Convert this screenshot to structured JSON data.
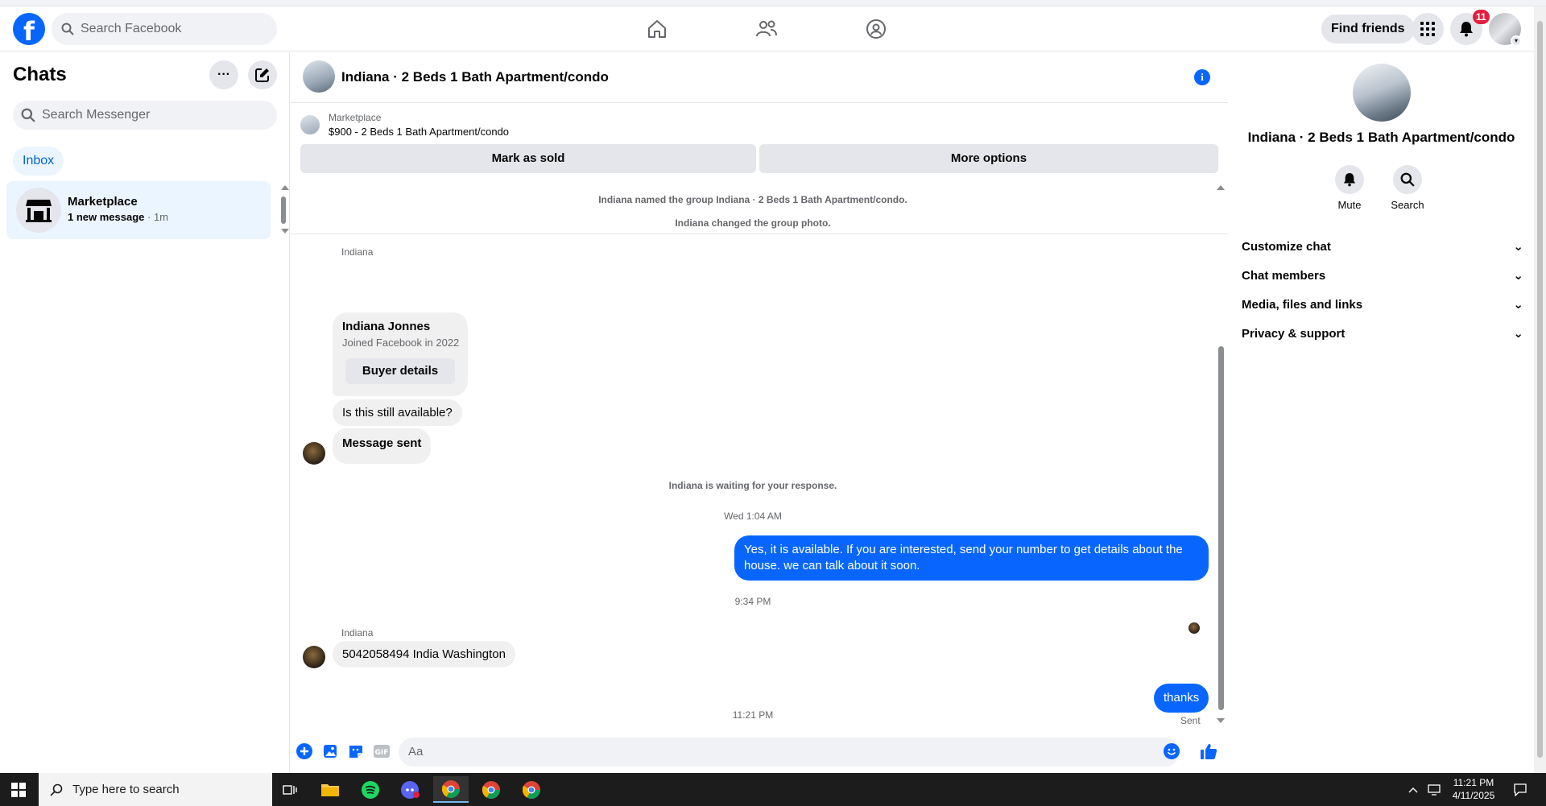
{
  "header": {
    "search_placeholder": "Search Facebook",
    "find_friends": "Find friends",
    "notifications_count": "11"
  },
  "sidebar": {
    "title": "Chats",
    "search_placeholder": "Search Messenger",
    "inbox_label": "Inbox",
    "chats": [
      {
        "name": "Marketplace",
        "preview": "1 new message",
        "time": " · 1m"
      }
    ]
  },
  "conversation": {
    "title": "Indiana · 2 Beds 1 Bath Apartment/condo",
    "marketplace_label": "Marketplace",
    "listing": "$900 - 2 Beds 1 Bath Apartment/condo",
    "mark_sold": "Mark as sold",
    "more_options": "More options",
    "system_1": "Indiana named the group Indiana · 2 Beds 1 Bath Apartment/condo.",
    "system_2": "Indiana changed the group photo.",
    "sender_1": "Indiana",
    "card_name": "Indiana Jonnes",
    "card_sub": "Joined Facebook in 2022",
    "card_button": "Buyer details",
    "msg_available": "Is this still available?",
    "msg_sent": "Message sent",
    "system_wait": "Indiana is waiting for your response.",
    "time_1": "Wed 1:04 AM",
    "out_1": "Yes, it is available. If you are interested, send your number to get details about the house. we can talk about it soon.",
    "time_2": "9:34 PM",
    "sender_2": "Indiana",
    "msg_number": "5042058494 India Washington",
    "time_3": "11:21 PM",
    "out_2": "thanks",
    "sent_status": "Sent",
    "composer_placeholder": "Aa"
  },
  "info_panel": {
    "title": "Indiana · 2 Beds 1 Bath Apartment/condo",
    "mute": "Mute",
    "search": "Search",
    "sections": [
      "Customize chat",
      "Chat members",
      "Media, files and links",
      "Privacy & support"
    ]
  },
  "taskbar": {
    "search_placeholder": "Type here to search",
    "time": "11:21 PM",
    "date": "4/11/2025"
  },
  "colors": {
    "brand": "#0866ff",
    "badge": "#e41e3f"
  }
}
